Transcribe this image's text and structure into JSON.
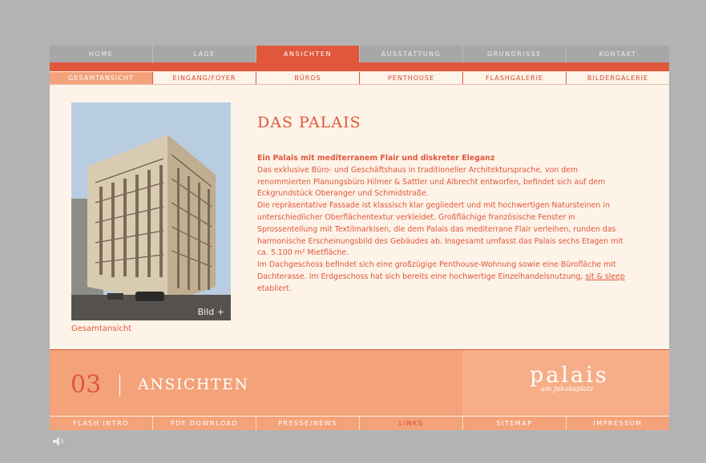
{
  "topnav": [
    "HOME",
    "LAGE",
    "ANSICHTEN",
    "AUSSTATTUNG",
    "GRUNDRISSE",
    "KONTAKT"
  ],
  "subnav": [
    "GESAMTANSICHT",
    "EINGANG/FOYER",
    "BÜROS",
    "PENTHOUSE",
    "FLASHGALERIE",
    "BILDERGALERIE"
  ],
  "photo": {
    "button_label": "Bild +",
    "caption": "Gesamtansicht"
  },
  "content": {
    "title": "DAS PALAIS",
    "lead": "Ein Palais mit mediterranem Flair und diskreter Eleganz",
    "para1": "Das exklusive Büro- und Geschäftshaus in traditioneller Architektursprache, von dem renommierten Planungsbüro Hilmer & Sattler und Albrecht entworfen, befindet sich auf dem Eckgrundstück Oberanger und Schmidstraße.",
    "para2": "Die repräsentative Fassade ist klassisch klar gegliedert und mit hochwertigen Natursteinen in unterschiedlicher Oberflächentextur verkleidet. Großflächige französische Fenster in Sprossenteilung mit Textilmarkisen, die dem Palais das mediterrane Flair verleihen, runden das harmonische Erscheinungsbild des Gebäudes ab. Insgesamt umfasst das Palais sechs Etagen mit ca. 5.100 m² Mietfläche.",
    "para3_before": "Im Dachgeschoss befindet sich eine großzügige Penthouse-Wohnung sowie eine Bürofläche mit Dachterasse. Im Erdgeschoss hat sich bereits eine hochwertige Einzelhandelsnutzung, ",
    "para3_link": "sit & sleep",
    "para3_after": " etabliert."
  },
  "band": {
    "number": "03",
    "section": "ANSICHTEN",
    "logo_main": "palais",
    "logo_sub": "am Jakobsplatz"
  },
  "footnav": [
    "FLASH INTRO",
    "PDF DOWNLOAD",
    "PRESSE/NEWS",
    "LINKS",
    "SITEMAP",
    "IMPRESSUM"
  ],
  "sound_icon": "speaker-icon",
  "colors": {
    "accent": "#e0573b",
    "peach": "#f3a27a",
    "cream": "#fdf3e8",
    "gray": "#b3b3b3"
  }
}
